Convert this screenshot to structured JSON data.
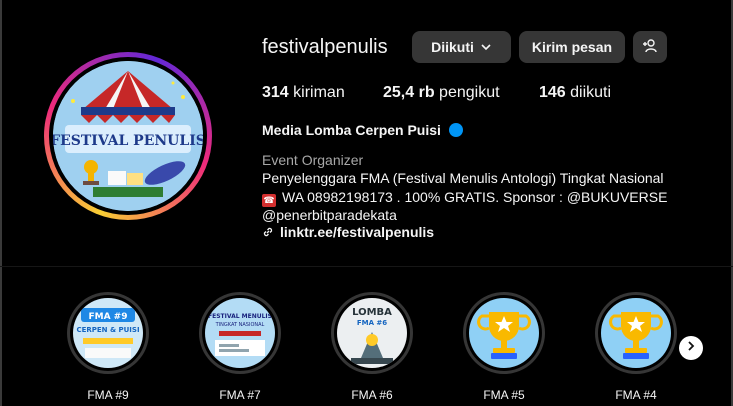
{
  "profile": {
    "username": "festivalpenulis",
    "follow_label": "Diikuti",
    "message_label": "Kirim pesan",
    "avatar_text": "FESTIVAL PENULIS"
  },
  "stats": [
    {
      "count": "314",
      "label": " kiriman"
    },
    {
      "count": "25,4 rb",
      "label": " pengikut"
    },
    {
      "count": "146",
      "label": " diikuti"
    }
  ],
  "bio": {
    "name": "Media Lomba Cerpen Puisi",
    "category": "Event Organizer",
    "line1": "Penyelenggara FMA (Festival Menulis Antologi) Tingkat Nasional",
    "line2": "WA 08982198173 . 100% GRATIS. Sponsor : @BUKUVERSE",
    "line3": "@penerbitparadekata",
    "link": "linktr.ee/festivalpenulis"
  },
  "highlights": [
    {
      "label": "FMA #9",
      "title": "FMA #9",
      "subtitle": "CERPEN & PUISI"
    },
    {
      "label": "FMA #7",
      "title": "FESTIVAL MENULIS",
      "subtitle": "TINGKAT NASIONAL"
    },
    {
      "label": "FMA #6",
      "title": "LOMBA",
      "subtitle": "FMA #6"
    },
    {
      "label": "FMA #5"
    },
    {
      "label": "FMA #4"
    }
  ],
  "icons": {
    "add_person": "add-person-icon",
    "chevron": "chevron-down-icon",
    "link": "link-icon",
    "next": "chevron-right-icon",
    "verified": "verified-badge-icon"
  }
}
